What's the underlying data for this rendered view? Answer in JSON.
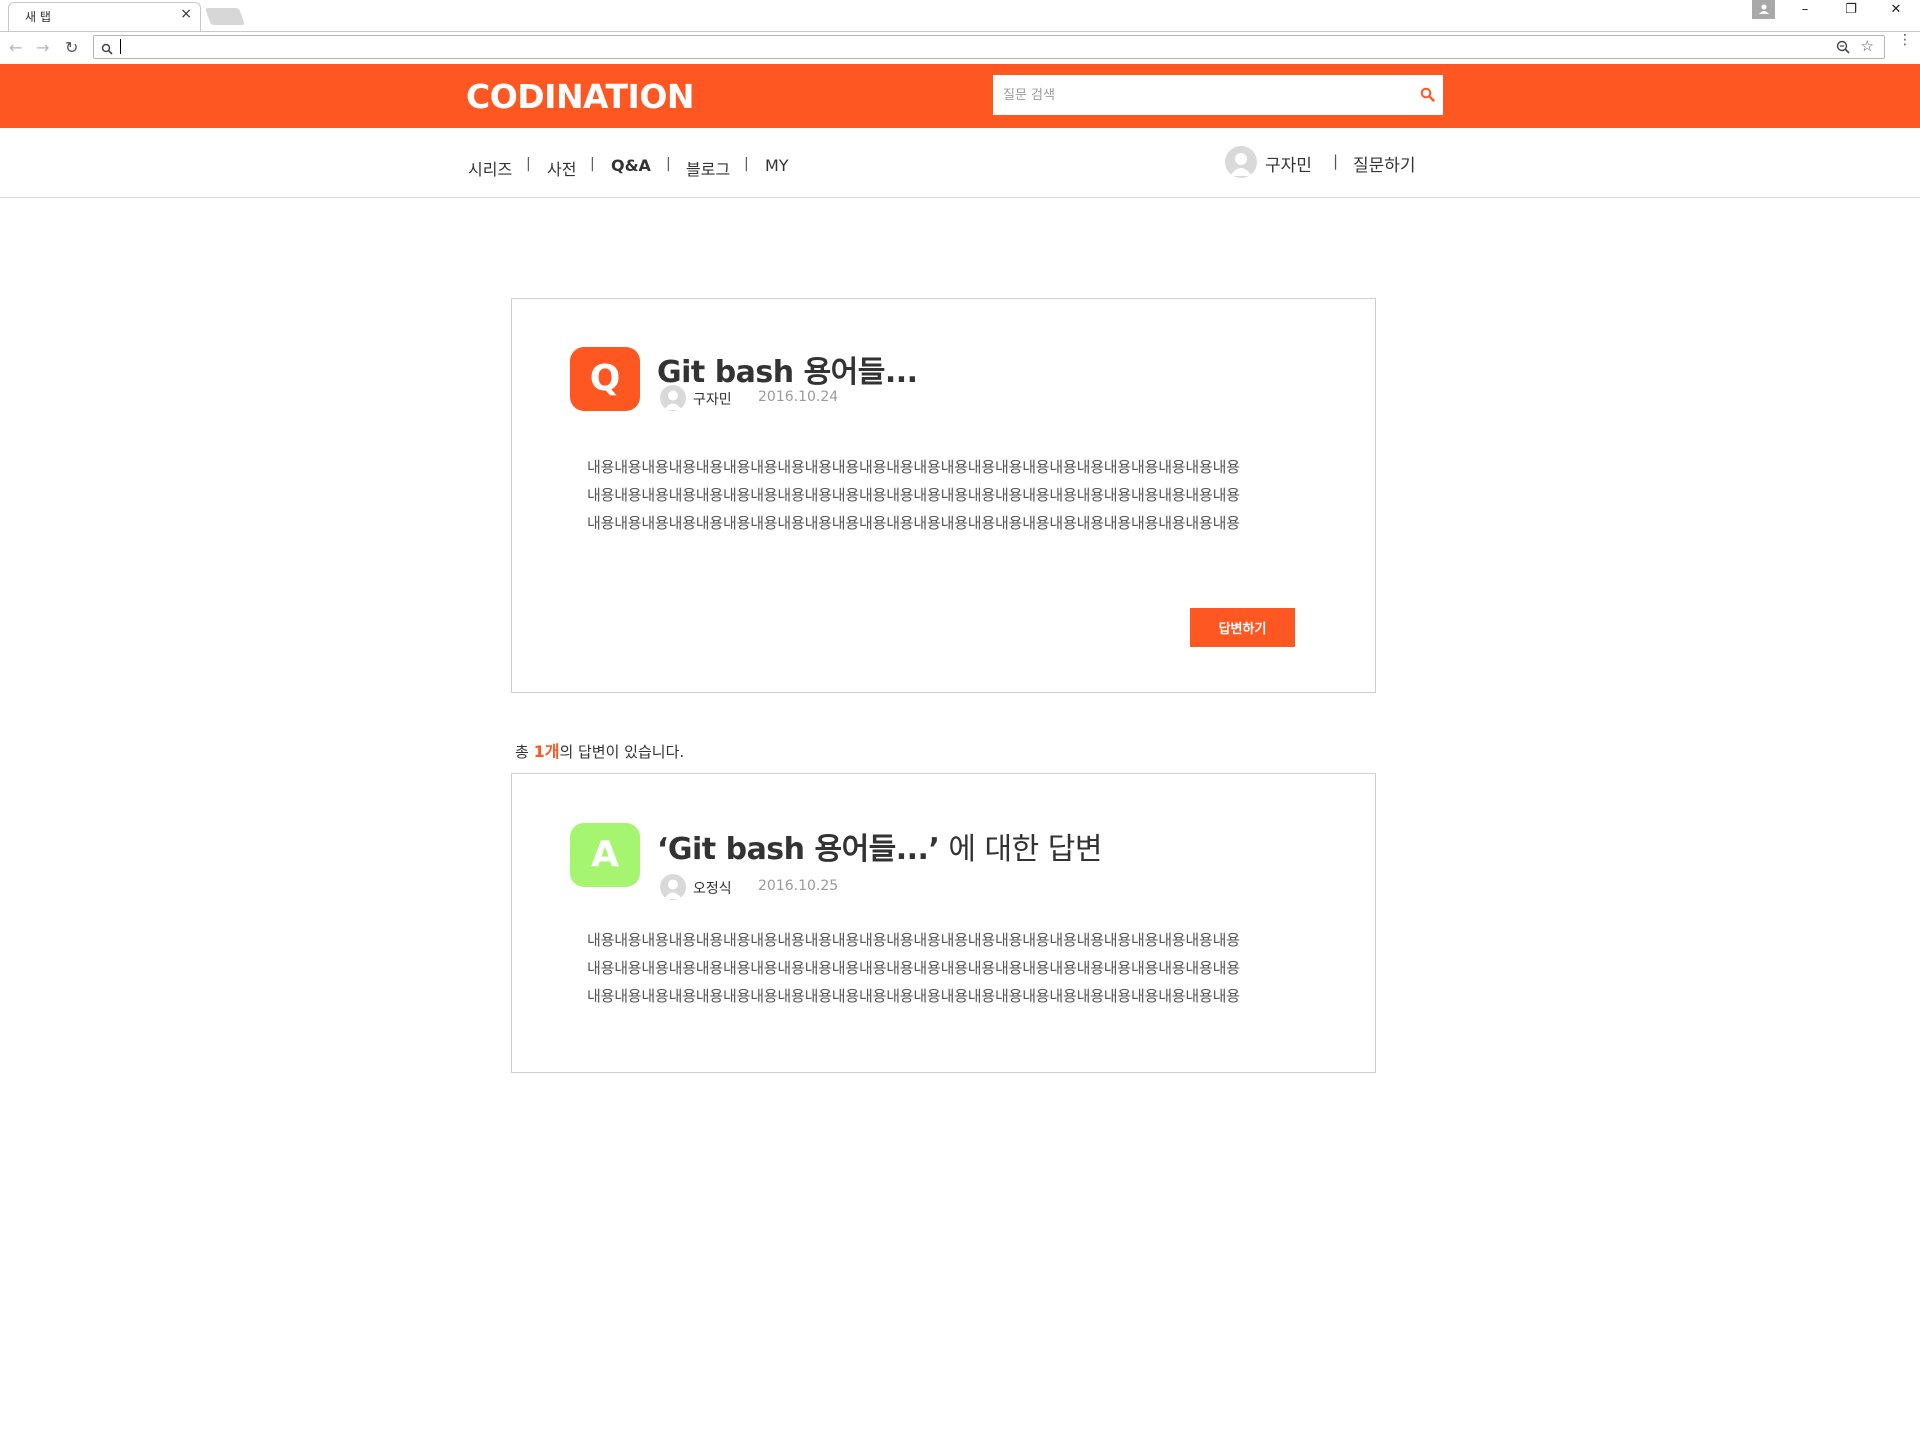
{
  "browser": {
    "tab_title": "새 탭",
    "tab_close": "×",
    "min_glyph": "–",
    "restore_glyph": "❐",
    "close_glyph": "✕",
    "back_glyph": "←",
    "forward_glyph": "→",
    "reload_glyph": "↻",
    "star_glyph": "☆",
    "menu_glyph": "⋮",
    "address_value": ""
  },
  "header": {
    "logo": "CODINATION",
    "search_placeholder": "질문 검색",
    "accent_color": "#ff5722"
  },
  "nav": {
    "items": [
      {
        "label": "시리즈"
      },
      {
        "label": "사전"
      },
      {
        "label": "Q&A"
      },
      {
        "label": "블로그"
      },
      {
        "label": "MY"
      }
    ],
    "separator": "|",
    "user_name": "구자민",
    "ask_label": "질문하기"
  },
  "question": {
    "badge": "Q",
    "title": "Git bash 용어들...",
    "author": "구자민",
    "date": "2016.10.24",
    "body_lines": [
      "내용내용내용내용내용내용내용내용내용내용내용내용내용내용내용내용내용내용내용내용내용내용내용내용",
      "내용내용내용내용내용내용내용내용내용내용내용내용내용내용내용내용내용내용내용내용내용내용내용내용",
      "내용내용내용내용내용내용내용내용내용내용내용내용내용내용내용내용내용내용내용내용내용내용내용내용"
    ],
    "reply_label": "답변하기"
  },
  "answer_count": {
    "prefix": "총 ",
    "count": "1개",
    "suffix": "의 답변이 있습니다."
  },
  "answer": {
    "badge": "A",
    "title_bold": "‘Git bash 용어들...’",
    "title_rest": " 에 대한 답변",
    "author": "오정식",
    "date": "2016.10.25",
    "body_lines": [
      "내용내용내용내용내용내용내용내용내용내용내용내용내용내용내용내용내용내용내용내용내용내용내용내용",
      "내용내용내용내용내용내용내용내용내용내용내용내용내용내용내용내용내용내용내용내용내용내용내용내용",
      "내용내용내용내용내용내용내용내용내용내용내용내용내용내용내용내용내용내용내용내용내용내용내용내용"
    ]
  }
}
